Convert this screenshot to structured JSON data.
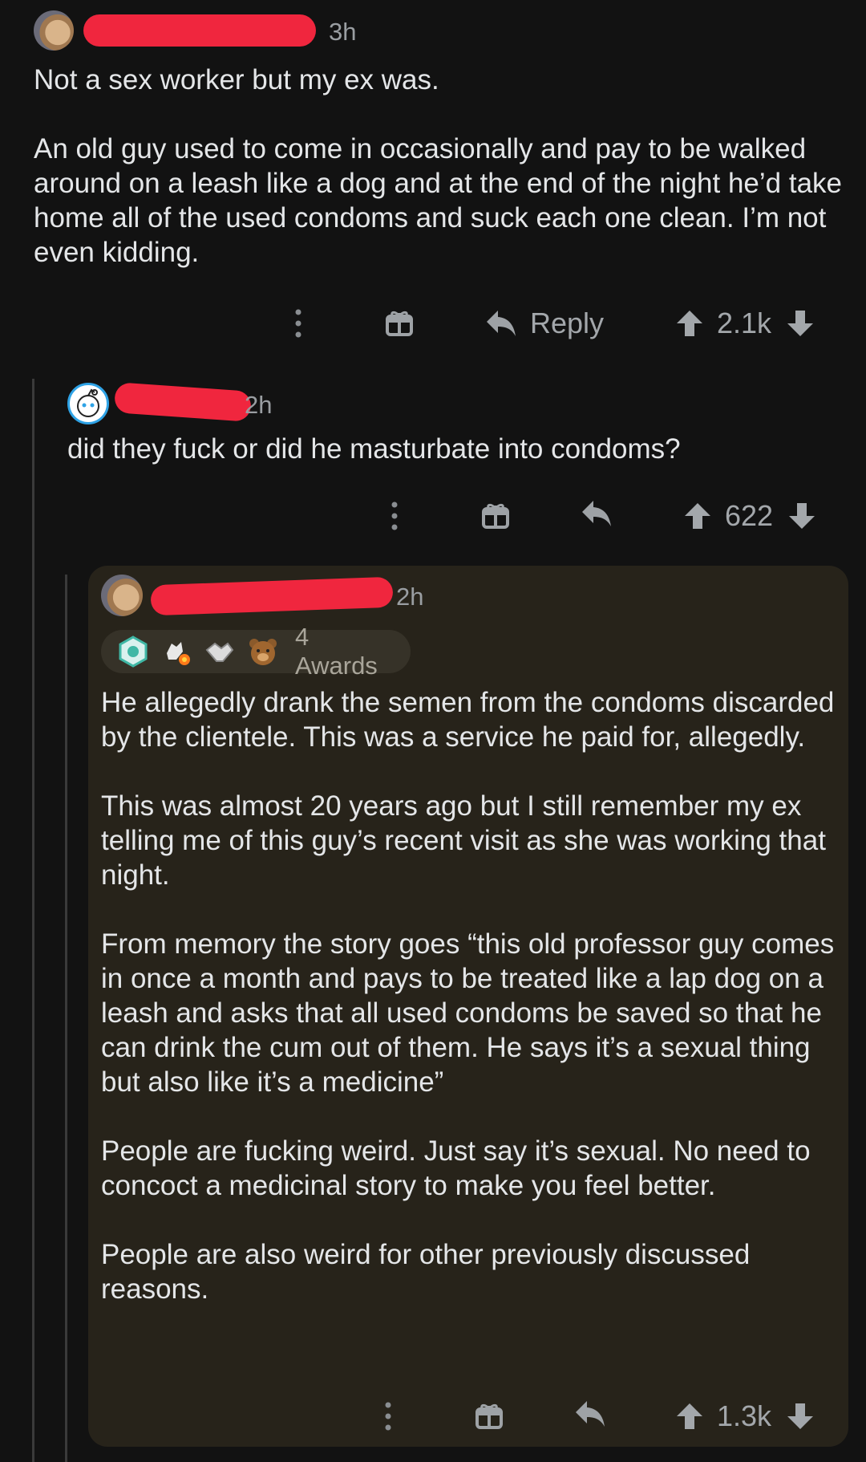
{
  "comments": [
    {
      "time": "3h",
      "body": [
        "Not a sex worker but my ex was.",
        "An old guy used to come in occasionally and pay to be walked around on a leash like a dog and at the end of the night he’d take home all of the used condoms and suck each one clean. I’m not even kidding."
      ],
      "reply_label": "Reply",
      "score": "2.1k"
    },
    {
      "time": "2h",
      "body": [
        "did they fuck or did he masturbate into condoms?"
      ],
      "score": "622"
    },
    {
      "time": "2h",
      "awards_label": "4 Awards",
      "body": [
        "He allegedly drank the semen from the condoms discarded by the clientele. This was a service he paid for, allegedly.",
        "This was almost 20 years ago but I still remember my ex telling me of this guy’s recent visit as she was working that night.",
        "From memory the story goes “this old professor guy comes in once a month and pays to be treated like a lap dog on a leash and asks that all used condoms be saved so that he can drink the cum out of them. He says it’s a sexual thing but also like it’s a medicine”",
        "People are fucking weird. Just say it’s sexual. No need to concoct a medicinal story to make you feel better.",
        "People are also weird for other previously discussed reasons."
      ],
      "score": "1.3k"
    }
  ],
  "colors": {
    "background": "#121212",
    "highlight_card": "#27231a",
    "redaction": "#f0263e",
    "meta_text": "#9a9ea2"
  },
  "icons": [
    "more-vertical-icon",
    "gift-icon",
    "reply-arrow-icon",
    "upvote-icon",
    "downvote-icon"
  ]
}
